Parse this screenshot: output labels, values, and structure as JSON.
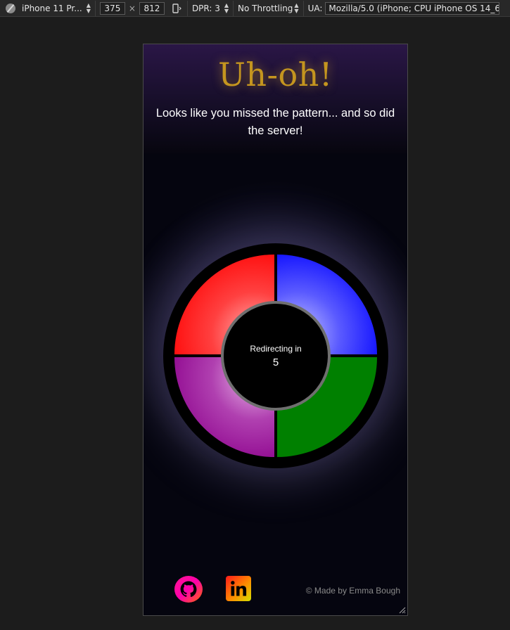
{
  "devtools": {
    "device_name": "iPhone 11 Pr...",
    "width": "375",
    "times": "×",
    "height": "812",
    "dpr": "DPR: 3",
    "throttling": "No Throttling",
    "ua_label": "UA:",
    "ua_value": "Mozilla/5.0 (iPhone; CPU iPhone OS 14_6 like M"
  },
  "page": {
    "title": "Uh-oh!",
    "subtitle": "Looks like you missed the pattern... and so did the server!",
    "redirect_label": "Redirecting in",
    "countdown": "5",
    "copyright": "© Made by Emma Bough"
  },
  "colors": {
    "title": "#c4951f",
    "pad_red": "#ff0000",
    "pad_blue": "#0000ff",
    "pad_purple": "#8b008b",
    "pad_green": "#008000"
  },
  "icons": {
    "github": "github-icon",
    "linkedin": "linkedin-icon"
  }
}
